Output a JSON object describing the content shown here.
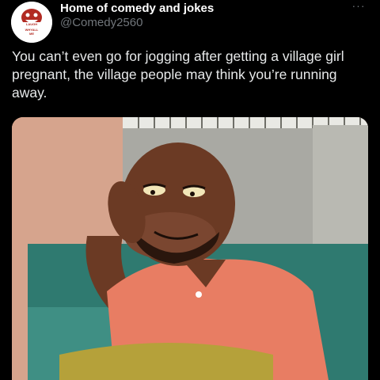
{
  "post": {
    "author_name": "Home of comedy and jokes",
    "author_handle": "@Comedy2560",
    "avatar_icon": "laughing-logo-avatar",
    "avatar_text": "LAUGH WHYALL ME",
    "more_icon": "more-options-icon",
    "more_glyph": "···",
    "text": "You can’t even go for jogging after getting a village girl pregnant, the village people may think you’re running away."
  },
  "media": {
    "description_icon": "cartoon-man-meme-image"
  },
  "colors": {
    "background": "#000000",
    "text": "#e7e9ea",
    "secondary": "#71767b"
  }
}
